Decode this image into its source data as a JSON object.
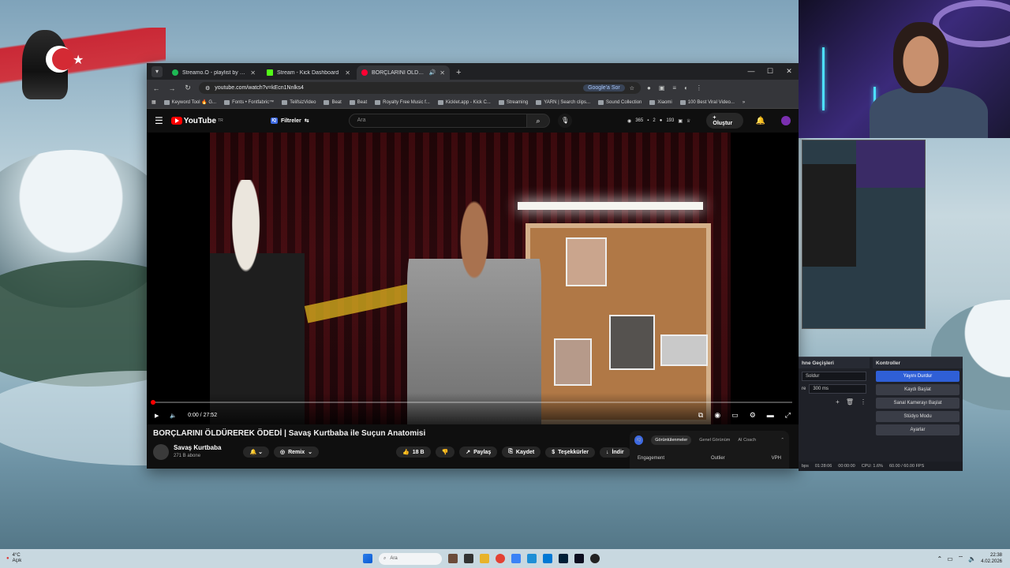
{
  "flag_star": "★",
  "browser": {
    "tabs": [
      {
        "title": "Streamo.O - playlist by Shape",
        "color": "#1db954"
      },
      {
        "title": "Stream - Kick Dashboard",
        "color": "#53fc18"
      },
      {
        "title": "BORÇLARINI ÖLDÜREREK Ö",
        "color": "#ff0033"
      }
    ],
    "address": "youtube.com/watch?v=kEcn1Nnlks4",
    "google_sor": "Google'a Sor",
    "bookmarks": [
      "Keyword Tool 🔥 G...",
      "Fonts • Fontfabric™",
      "TelifsizVideo",
      "Beat",
      "Beat",
      "Royalty Free Music f...",
      "Kicklet.app - Kick C...",
      "Streaming",
      "YARN | Search clips...",
      "Sound Collection",
      "Xiaomi",
      "100 Best Viral Video..."
    ]
  },
  "youtube": {
    "logo": "YouTube",
    "region": "TR",
    "filters": "Filtreler",
    "filters_badge": "IQ",
    "search_placeholder": "Ara",
    "stats": {
      "a": "365",
      "b": "2",
      "c": "193"
    },
    "create": "Oluştur",
    "time": "0:00 / 27:52",
    "video_title": "BORÇLARINI ÖLDÜREREK ÖDEDİ | Savaş Kurtbaba ile Suçun Anatomisi",
    "channel": "Savaş Kurtbaba",
    "subscribers": "271 B abone",
    "remix": "Remix",
    "likes": "18 B",
    "share": "Paylaş",
    "save": "Kaydet",
    "thanks": "Teşekkürler",
    "download": "İndir",
    "side_badge": "IQ",
    "side_tabs": [
      "Görüntülenmeler",
      "Genel Görünüm",
      "AI Coach"
    ],
    "side_cols": [
      "Engagement",
      "Outlier",
      "VPH"
    ]
  },
  "obs": {
    "transitions_title": "hne Geçişleri",
    "transition_value": "Soldur",
    "duration_label": "re",
    "duration": "300 ms",
    "controls_title": "Kontroller",
    "buttons": [
      "Yayını Durdur",
      "Kaydı Başlat",
      "Sanal Kamerayı Başlat",
      "Stüdyo Modu",
      "Ayarlar"
    ],
    "status": [
      "bps",
      "01:28:06",
      "00:00:00",
      "CPU: 1.6%",
      "60.00 / 60.00 FPS"
    ]
  },
  "taskbar": {
    "temp": "4°C",
    "weather": "Açık",
    "search": "Ara",
    "time": "22:38",
    "date": "4.02.2026"
  }
}
